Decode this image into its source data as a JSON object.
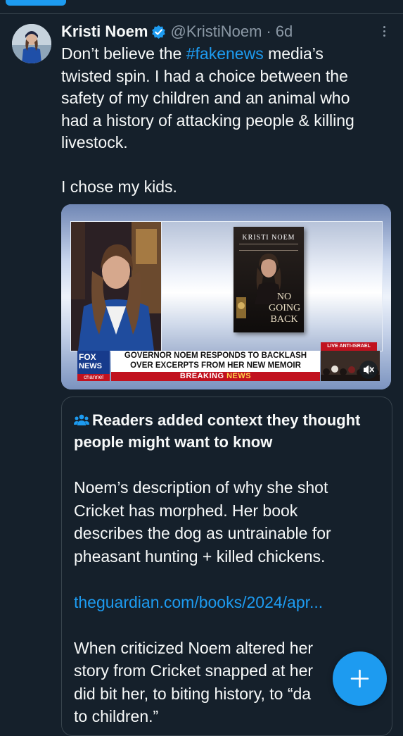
{
  "tweet": {
    "author_name": "Kristi Noem",
    "handle": "@KristiNoem",
    "time_separator": "·",
    "timestamp": "6d",
    "text_lines": [
      "Don’t believe the",
      "#fakenews",
      "media’s",
      "twisted spin. I had a choice between the",
      "safety of my children and an animal who",
      "had a history of attacking people & killing",
      "livestock.",
      "I chose my kids."
    ]
  },
  "media": {
    "book_author": "KRISTI NOEM",
    "book_title_lines": [
      "NO",
      "GOING",
      "BACK"
    ],
    "network_logo_line1": "FOX",
    "network_logo_line2": "NEWS",
    "network_logo_line3": "channel",
    "headline_line1": "GOVERNOR NOEM RESPONDS TO BACKLASH",
    "headline_line2": "OVER EXCERPTS FROM HER NEW MEMOIR",
    "banner_breaking": "BREAKING",
    "banner_news": "NEWS",
    "live_label": "LIVE ANTI-ISRAEL PROTESTS"
  },
  "community_note": {
    "header": "Readers added context they thought people might want to know",
    "paragraph1_lines": [
      "Noem’s description of why she shot",
      "Cricket has morphed. Her book",
      "describes the dog as  untrainable for",
      "pheasant hunting + killed chickens."
    ],
    "link": "theguardian.com/books/2024/apr...",
    "paragraph2_lines": [
      "When criticized Noem altered her",
      "story from Cricket snapped at her",
      "did bit her, to biting history, to “da",
      "to children.”"
    ]
  },
  "colors": {
    "background": "#15202b",
    "accent": "#1d9bf0",
    "secondary_text": "#8b98a5",
    "border": "#38444d"
  },
  "icons": {
    "verified": "verified-badge-icon",
    "more": "more-options-icon",
    "people": "people-icon",
    "compose": "plus-icon",
    "mute": "speaker-muted-icon"
  }
}
